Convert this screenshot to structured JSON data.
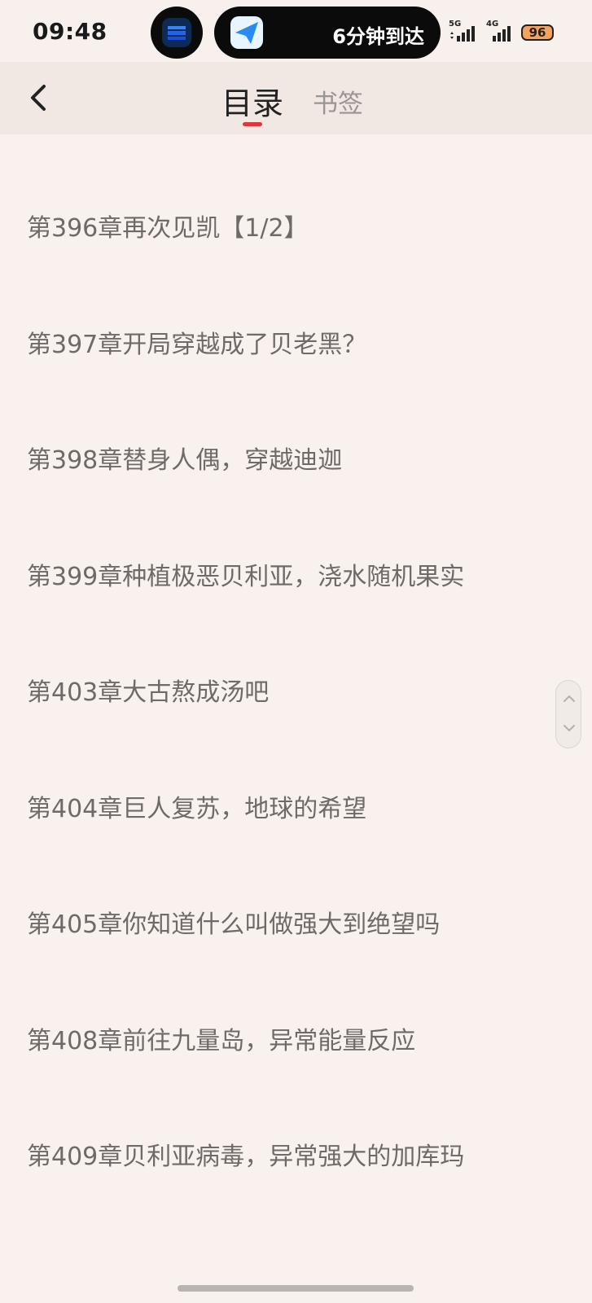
{
  "status_bar": {
    "time": "09:48",
    "eta_text": "6分钟到达",
    "signal1_label": "5G",
    "signal2_label": "4G",
    "battery": "96"
  },
  "header": {
    "tab_toc": "目录",
    "tab_bookmarks": "书签"
  },
  "chapters": [
    "第396章再次见凯【1/2】",
    "第397章开局穿越成了贝老黑？",
    "第398章替身人偶，穿越迪迦",
    "第399章种植极恶贝利亚，浇水随机果实",
    "第403章大古熬成汤吧",
    "第404章巨人复苏，地球的希望",
    "第405章你知道什么叫做强大到绝望吗",
    "第408章前往九量岛，异常能量反应",
    "第409章贝利亚病毒，异常强大的加库玛"
  ],
  "colors": {
    "accent": "#e0353b",
    "background": "#f9f1ed",
    "header_bg": "#f1e7e3",
    "chapter_text": "#6e6a68"
  }
}
